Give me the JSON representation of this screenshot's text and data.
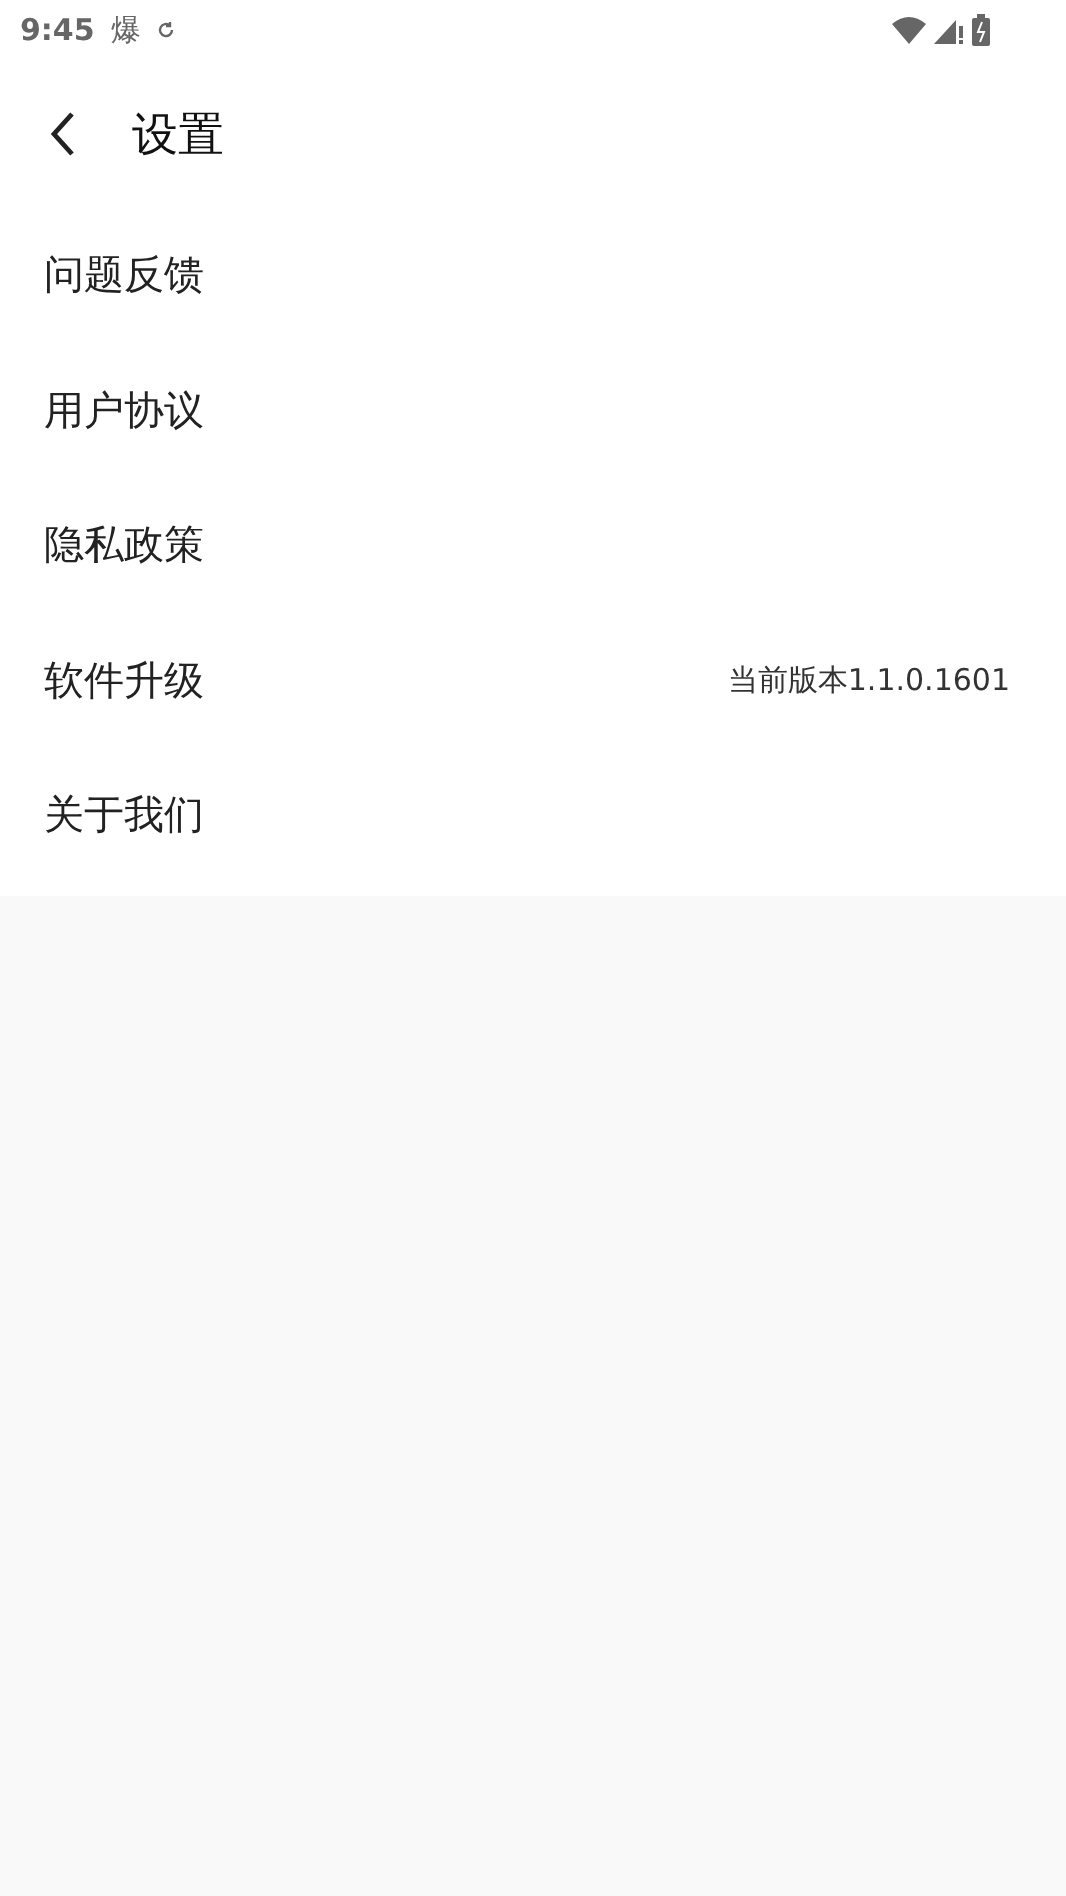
{
  "status_bar": {
    "time": "9:45",
    "notification": "爆"
  },
  "header": {
    "title": "设置"
  },
  "items": [
    {
      "label": "问题反馈"
    },
    {
      "label": "用户协议"
    },
    {
      "label": "隐私政策"
    },
    {
      "label": "软件升级",
      "value": "当前版本1.1.0.1601"
    },
    {
      "label": "关于我们"
    }
  ]
}
